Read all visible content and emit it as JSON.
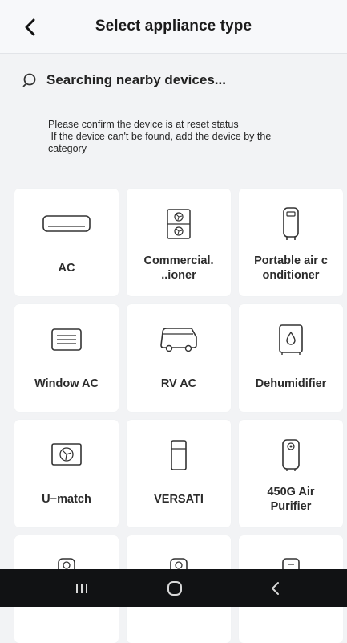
{
  "header": {
    "title": "Select appliance type"
  },
  "search": {
    "status": "Searching nearby devices..."
  },
  "notice": {
    "line1": "Please confirm the device is at reset status",
    "line2": " If the device can't be found, add the device by the",
    "line3": "category"
  },
  "appliances": [
    {
      "label": "AC",
      "icon": "split-ac-icon"
    },
    {
      "label": "Commercial.\n..ioner",
      "icon": "commercial-ac-icon"
    },
    {
      "label": "Portable air c\nonditioner",
      "icon": "portable-ac-icon"
    },
    {
      "label": "Window AC",
      "icon": "window-ac-icon"
    },
    {
      "label": "RV AC",
      "icon": "rv-ac-icon"
    },
    {
      "label": "Dehumidifier",
      "icon": "dehumidifier-icon"
    },
    {
      "label": "U−match",
      "icon": "u-match-icon"
    },
    {
      "label": "VERSATI",
      "icon": "versati-icon"
    },
    {
      "label": "450G Air\nPurifier",
      "icon": "air-purifier-icon"
    },
    {
      "label": "",
      "icon": "appliance-icon"
    },
    {
      "label": "",
      "icon": "appliance-icon"
    },
    {
      "label": "",
      "icon": "appliance-icon"
    }
  ],
  "system_nav": {
    "recents": "recents-icon",
    "home": "home-icon",
    "back": "back-icon"
  }
}
